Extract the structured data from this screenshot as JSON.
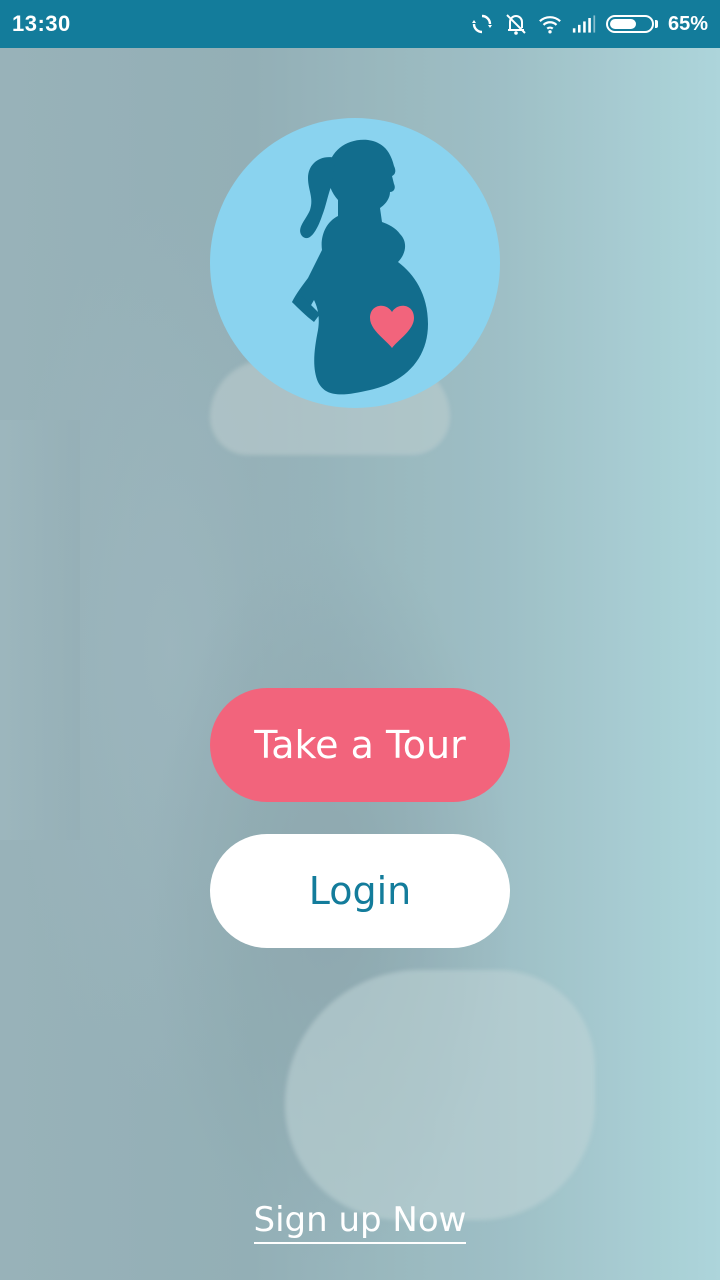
{
  "status_bar": {
    "time": "13:30",
    "icons": [
      "sync-icon",
      "vibrate-off-icon",
      "wifi-icon",
      "signal-icon",
      "battery-icon"
    ],
    "battery_percent_text": "65%",
    "battery_level": 0.65,
    "bar_color": "#137c9b"
  },
  "logo": {
    "icon": "pregnant-woman-heart-icon",
    "circle_color": "#8ad3ef",
    "silhouette_color": "#126d8d",
    "heart_color": "#f2647c"
  },
  "actions": {
    "tour_label": "Take a Tour",
    "login_label": "Login",
    "signup_label": "Sign up Now"
  },
  "colors": {
    "tour_button": "#f2647c",
    "login_button": "#ffffff",
    "login_text": "#137c9b"
  }
}
